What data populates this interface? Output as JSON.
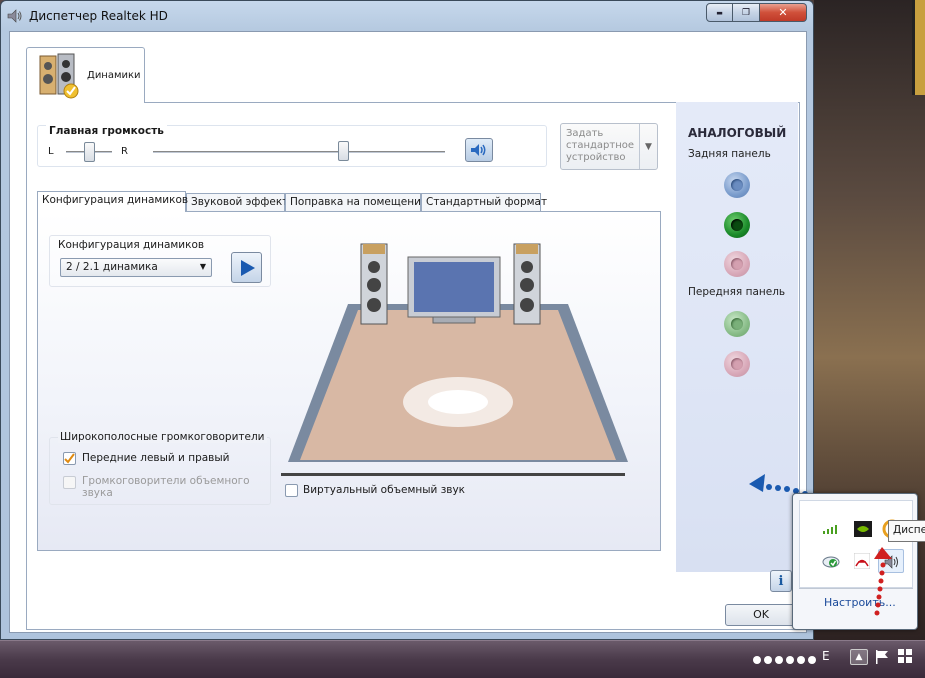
{
  "window": {
    "title": "Диспетчер Realtek HD",
    "caption": {
      "minimize": "▬",
      "maximize": "❐",
      "close": "✕"
    }
  },
  "main_tab": {
    "label": "Динамики",
    "icon": "speakers-icon"
  },
  "volume": {
    "title": "Главная громкость",
    "left": "L",
    "right": "R",
    "balance_level": 0.5,
    "volume_level": 0.65,
    "mute_icon": "speaker-volume-icon"
  },
  "set_default": {
    "label": "Задать стандартное устройство"
  },
  "subtabs": [
    {
      "label": "Конфигурация динамиков"
    },
    {
      "label": "Звуковой эффект"
    },
    {
      "label": "Поправка на помещение"
    },
    {
      "label": "Стандартный формат"
    }
  ],
  "speaker_config": {
    "title": "Конфигурация динамиков",
    "selected": "2 / 2.1 динамика",
    "play_icon": "play-icon"
  },
  "fullrange": {
    "title": "Широкополосные громкоговорители",
    "front": {
      "label": "Передние левый и правый",
      "checked": true
    },
    "surround": {
      "label": "Громкоговорители объемного звука",
      "checked": false,
      "disabled": true
    }
  },
  "virtual_surround": {
    "label": "Виртуальный объемный звук",
    "checked": false
  },
  "buttons": {
    "ok": "OK",
    "info": "i"
  },
  "analog": {
    "title": "АНАЛОГОВЫЙ",
    "rear": "Задняя панель",
    "front": "Передняя панель",
    "rear_jacks": [
      "blue",
      "green",
      "pink"
    ],
    "front_jacks": [
      "lgreen",
      "pink"
    ],
    "colors": {
      "blue": "#7a9ccc",
      "green": "#1a8a2a",
      "pink": "#d8a8b8",
      "lgreen": "#88bc88"
    }
  },
  "tray": {
    "link": "Настроить...",
    "tooltip": "Диспе",
    "icons": [
      "signal-icon",
      "nvidia-icon",
      "updater-icon",
      "cloud-icon",
      "adobe-icon",
      "volume-icon"
    ]
  },
  "taskbar": {
    "lang": "E",
    "icons": [
      "show-hidden-icon",
      "flag-icon",
      "windows-icon"
    ]
  }
}
